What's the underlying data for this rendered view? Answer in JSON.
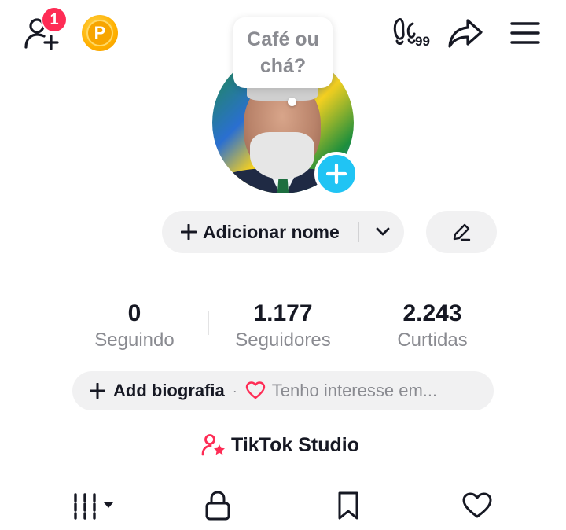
{
  "header": {
    "notification_count": "1",
    "coin_letter": "P",
    "accent_red": "#fe2c55",
    "accent_cyan": "#20c4f4"
  },
  "bubble": {
    "text": "Café ou\nchá?"
  },
  "profile": {
    "add_name_label": "Adicionar nome"
  },
  "stats": [
    {
      "value": "0",
      "label": "Seguindo"
    },
    {
      "value": "1.177",
      "label": "Seguidores"
    },
    {
      "value": "2.243",
      "label": "Curtidas"
    }
  ],
  "bio": {
    "add_label": "Add biografia",
    "separator": "·",
    "hint": "Tenho interesse em..."
  },
  "studio": {
    "label": "TikTok Studio"
  },
  "tabs": [
    "videos-grid",
    "private-lock",
    "saved-bookmark",
    "liked-heart"
  ]
}
